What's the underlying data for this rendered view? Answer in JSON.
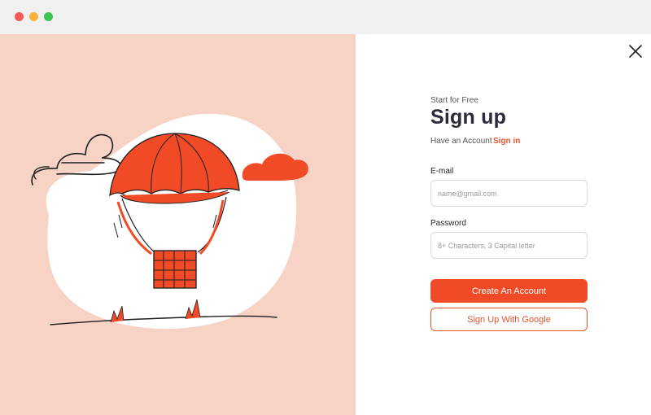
{
  "window": {
    "controls": [
      "close",
      "minimize",
      "maximize"
    ],
    "colors": {
      "close": "#f25c57",
      "minimize": "#f7b23b",
      "maximize": "#3cc554"
    }
  },
  "illustration": {
    "subject": "hot-air-balloon-icon",
    "background_color": "#f6d3c4",
    "accent_color": "#f04a26"
  },
  "form": {
    "subtitle": "Start for Free",
    "title": "Sign up",
    "have_account_text": "Have an Account",
    "signin_link": "Sign in",
    "email": {
      "label": "E-mail",
      "placeholder": "name@gmail.com",
      "value": ""
    },
    "password": {
      "label": "Password",
      "placeholder": "8+ Characters, 3 Capital letter",
      "value": ""
    },
    "create_button": "Create An Account",
    "google_button": "Sign Up With Google"
  },
  "colors": {
    "accent": "#f04a26",
    "title": "#2e2a3d"
  }
}
